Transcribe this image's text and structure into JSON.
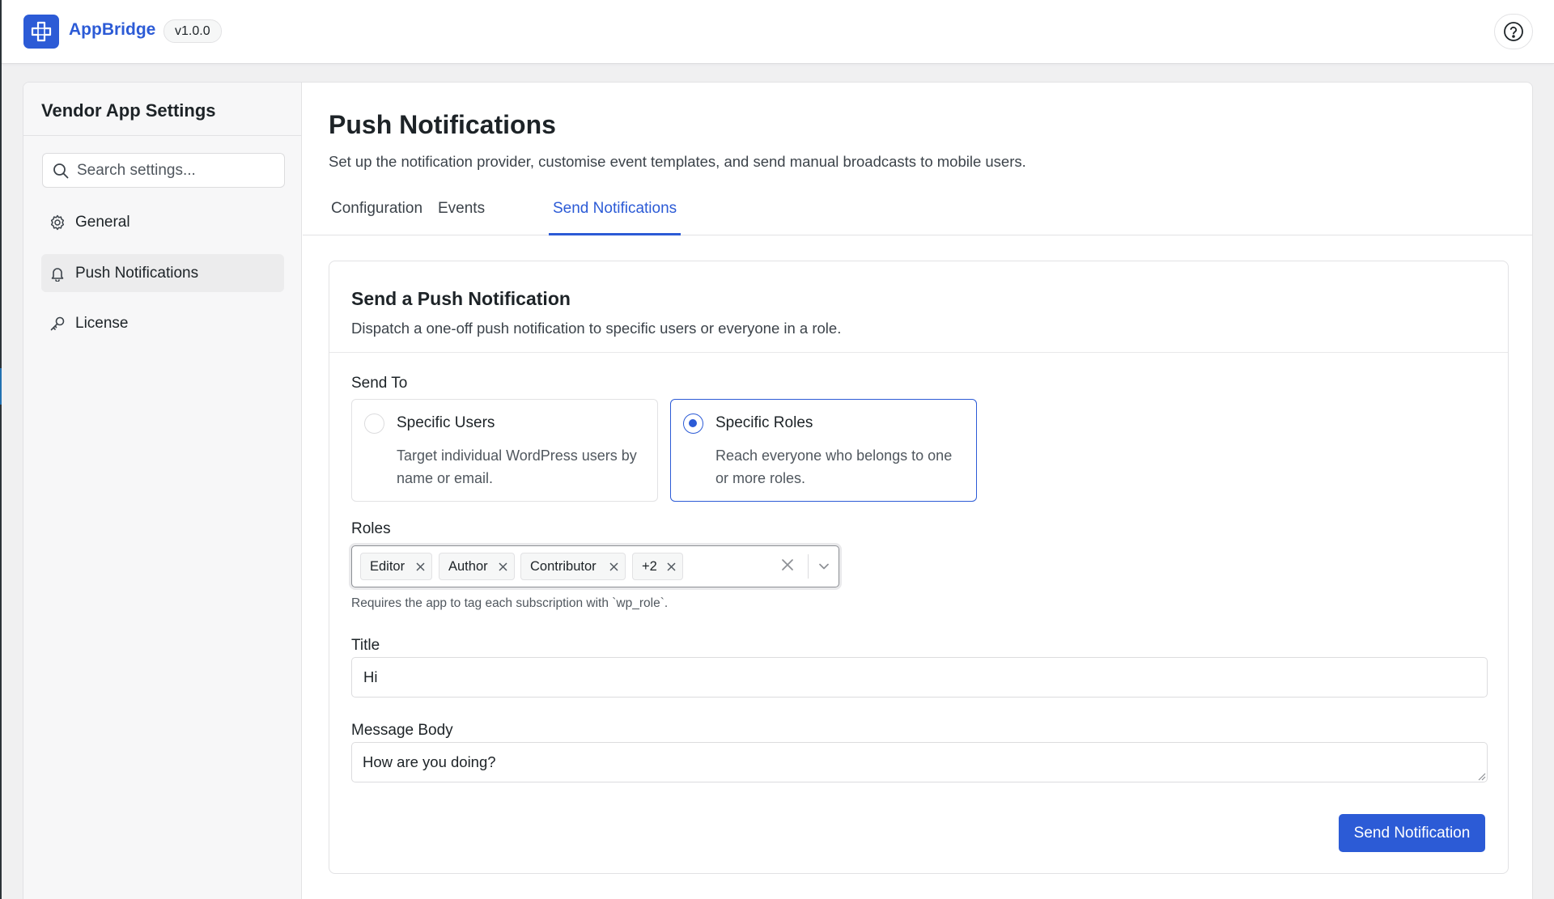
{
  "app": {
    "brand": "AppBridge",
    "version": "v1.0.0",
    "icons": {
      "logo": "plug-cross-icon",
      "help": "help-circle-icon"
    }
  },
  "sidebar": {
    "title": "Vendor App Settings",
    "search_placeholder": "Search settings...",
    "items": [
      {
        "label": "General",
        "icon": "gear-icon",
        "active": false
      },
      {
        "label": "Push Notifications",
        "icon": "bell-icon",
        "active": true
      },
      {
        "label": "License",
        "icon": "key-icon",
        "active": false
      }
    ]
  },
  "page": {
    "title": "Push Notifications",
    "subtitle": "Set up the notification provider, customise event templates, and send manual broadcasts to mobile users.",
    "tabs": [
      {
        "label": "Configuration",
        "active": false
      },
      {
        "label": "Events",
        "active": false
      },
      {
        "label": "Send Notifications",
        "active": true
      }
    ]
  },
  "card": {
    "title": "Send a Push Notification",
    "subtitle": "Dispatch a one-off push notification to specific users or everyone in a role.",
    "send_to_label": "Send To",
    "options": [
      {
        "title": "Specific Users",
        "description": "Target individual WordPress users by name or email.",
        "selected": false
      },
      {
        "title": "Specific Roles",
        "description": "Reach everyone who belongs to one or more roles.",
        "selected": true
      }
    ],
    "roles_label": "Roles",
    "roles_chips": [
      "Editor",
      "Author",
      "Contributor",
      "+2"
    ],
    "roles_hint": "Requires the app to tag each subscription with `wp_role`.",
    "title_label": "Title",
    "title_value": "Hi",
    "message_label": "Message Body",
    "message_value": "How are you doing?",
    "submit_label": "Send Notification"
  },
  "colors": {
    "accent": "#2c5bd6",
    "text": "#1d2327",
    "muted": "#50575e",
    "border": "#e2e2e4",
    "sidebar_bg": "#f7f7f8"
  }
}
